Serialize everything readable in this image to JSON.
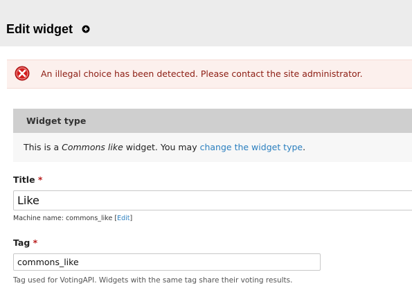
{
  "header": {
    "title": "Edit widget",
    "shortcut_icon": "plus-circle-icon"
  },
  "error": {
    "icon": "error-x-icon",
    "message": "An illegal choice has been detected. Please contact the site administrator.",
    "colors": {
      "background": "#fcf0ed",
      "text": "#8b1b11",
      "icon": "#d31e1e"
    }
  },
  "widget_type": {
    "legend": "Widget type",
    "text_before": "This is a ",
    "type_name": "Commons like",
    "text_middle": " widget. You may ",
    "link_label": "change the widget type",
    "text_after": "."
  },
  "title_field": {
    "label": "Title",
    "required_marker": "*",
    "value": "Like",
    "machine_name_prefix": "Machine name: commons_like ",
    "bracket_open": "[",
    "edit_link": "Edit",
    "bracket_close": "]"
  },
  "tag_field": {
    "label": "Tag",
    "required_marker": "*",
    "value": "commons_like",
    "description": "Tag used for VotingAPI. Widgets with the same tag share their voting results."
  },
  "colors": {
    "link": "#2b7fbf",
    "required": "#b91d1d",
    "header_bg": "#ececec"
  }
}
